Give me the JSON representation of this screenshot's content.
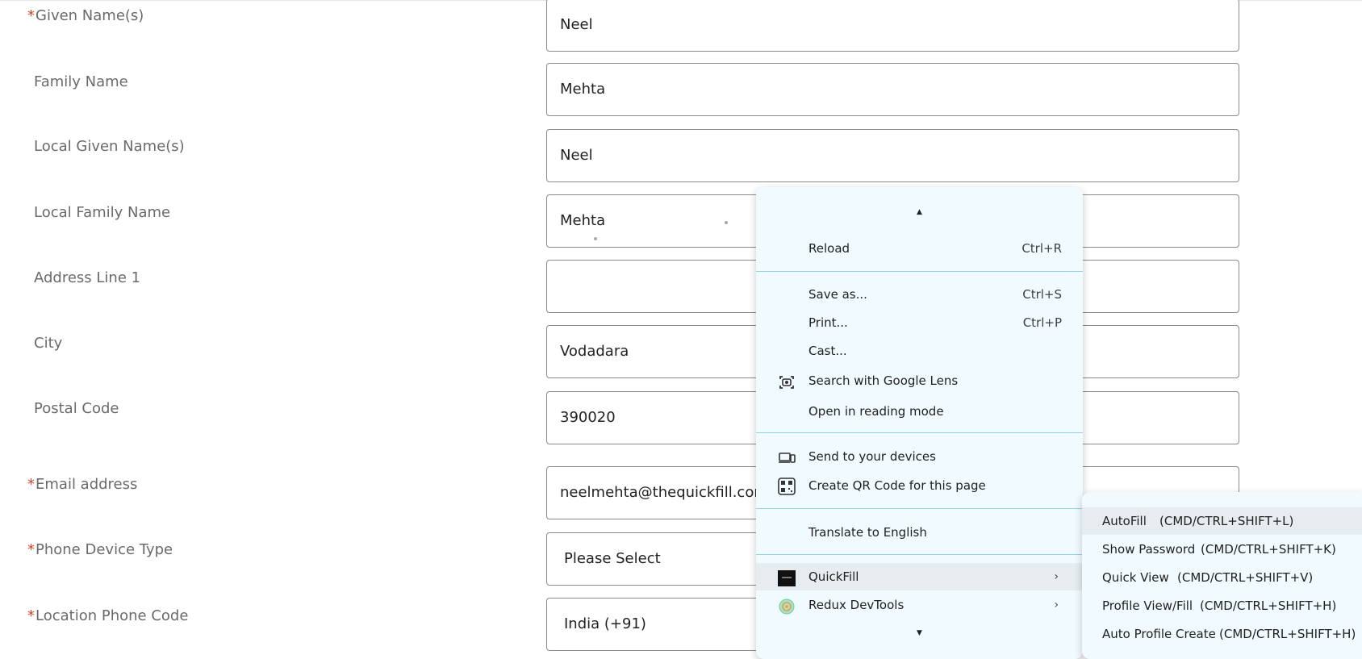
{
  "form": {
    "fields": [
      {
        "label": "Given Name(s)",
        "required": "*",
        "value": "Neel"
      },
      {
        "label": "Family Name",
        "required": "",
        "value": "Mehta"
      },
      {
        "label": "Local Given Name(s)",
        "required": "",
        "value": "Neel"
      },
      {
        "label": "Local Family Name",
        "required": "",
        "value": "Mehta"
      },
      {
        "label": "Address Line 1",
        "required": "",
        "value": ""
      },
      {
        "label": "City",
        "required": "",
        "value": "Vodadara"
      },
      {
        "label": "Postal Code",
        "required": "",
        "value": "390020"
      },
      {
        "label": "Email address",
        "required": "*",
        "value": "neelmehta@thequickfill.com"
      },
      {
        "label": "Phone Device Type",
        "required": "*",
        "value": "Please Select"
      },
      {
        "label": "Location Phone Code",
        "required": "*",
        "value": "India (+91)"
      }
    ]
  },
  "context_menu": {
    "reload": {
      "label": "Reload",
      "shortcut": "Ctrl+R"
    },
    "save_as": {
      "label": "Save as...",
      "shortcut": "Ctrl+S"
    },
    "print": {
      "label": "Print...",
      "shortcut": "Ctrl+P"
    },
    "cast": {
      "label": "Cast..."
    },
    "lens": {
      "label": "Search with Google Lens",
      "icon": "lens-icon"
    },
    "reading_mode": {
      "label": "Open in reading mode"
    },
    "send_devices": {
      "label": "Send to your devices",
      "icon": "devices-icon"
    },
    "qr_code": {
      "label": "Create QR Code for this page",
      "icon": "qr-code-icon"
    },
    "translate": {
      "label": "Translate to English"
    },
    "quickfill": {
      "label": "QuickFill",
      "icon": "quickfill-logo-icon"
    },
    "redux": {
      "label": "Redux DevTools",
      "icon": "redux-icon"
    }
  },
  "quickfill_submenu": [
    {
      "label": "AutoFill",
      "shortcut": "(CMD/CTRL+SHIFT+L)"
    },
    {
      "label": "Show Password",
      "shortcut": "(CMD/CTRL+SHIFT+K)"
    },
    {
      "label": "Quick View",
      "shortcut": "(CMD/CTRL+SHIFT+V)"
    },
    {
      "label": "Profile View/Fill",
      "shortcut": "(CMD/CTRL+SHIFT+H)"
    },
    {
      "label": "Auto Profile Create",
      "shortcut": "(CMD/CTRL+SHIFT+H)"
    }
  ],
  "colors": {
    "required_marker": "#d7422a",
    "menu_bg": "#f1fbff",
    "menu_separator": "#8fd4e8"
  }
}
